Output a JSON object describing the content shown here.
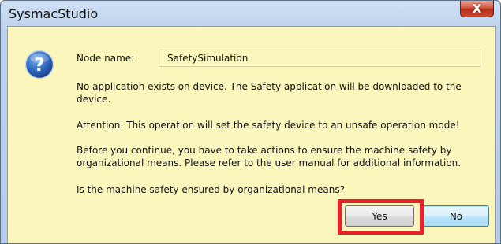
{
  "window": {
    "title": "SysmacStudio",
    "close_glyph": "X"
  },
  "icon": "question-icon",
  "node": {
    "label": "Node name:",
    "value": "SafetySimulation"
  },
  "messages": {
    "info": "No application exists on device. The Safety application will be downloaded to the device.",
    "attention": "Attention: This operation will set the safety device to an unsafe operation mode!",
    "instruction": "Before you continue, you have to take actions to ensure the machine safety by organizational means. Please refer to the user manual for additional information.",
    "question": "Is the machine safety ensured by organizational means?"
  },
  "buttons": {
    "yes": "Yes",
    "no": "No"
  },
  "colors": {
    "dialog_bg": "#fbf6bc",
    "highlight": "#e8232b",
    "close": "#c7492f"
  }
}
